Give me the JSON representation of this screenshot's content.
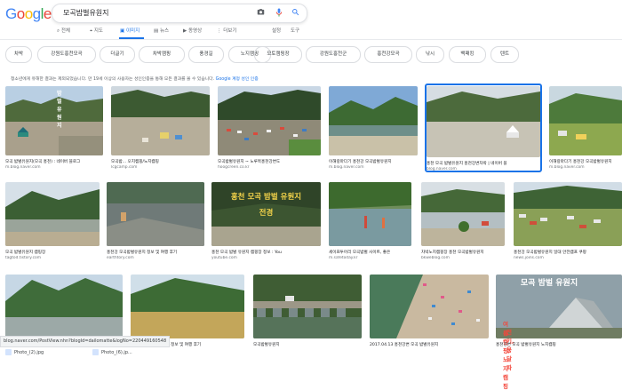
{
  "header": {
    "logo": "Google",
    "search_query": "모곡밤벌유원지",
    "settings_label": "설정",
    "tools_label": "도구"
  },
  "tabs": [
    {
      "label": "전체",
      "icon": "search-icon"
    },
    {
      "label": "지도",
      "icon": "map-pin-icon"
    },
    {
      "label": "이미지",
      "icon": "image-icon"
    },
    {
      "label": "뉴스",
      "icon": "news-icon"
    },
    {
      "label": "동영상",
      "icon": "video-icon"
    },
    {
      "label": "더보기",
      "icon": "more-icon"
    }
  ],
  "chips": [
    "차박",
    "강원도홍천모곡",
    "더글기",
    "차박캠핑",
    "풍경길",
    "노지캠핑",
    "모토캠핑장",
    "강원도홍천군",
    "홍천강모곡",
    "낚시",
    "백패킹",
    "텐트"
  ],
  "notice": {
    "text": "청소년에게 유해한 결과는 제외되었습니다. 만 19세 이상의 사용자는 성인인증을 통해 모든 결과를 볼 수 있습니다.",
    "link": "Google 계정 성인 인증"
  },
  "images": [
    {
      "caption": "모곡 밤벌유원지(모곡 홍천) : 네이버 블로그",
      "source": "m.blog.naver.com"
    },
    {
      "caption": "모곡밤... 오지캠핑/노지캠핑",
      "source": "lcgcamp.com"
    },
    {
      "caption": "모곡밤벌유원지 ~ 노루목홍천강변도",
      "source": "hoogcreen.co.kr"
    },
    {
      "caption": "이해랑마다기 홍천강 모곡밤벌유원지",
      "source": "m.blog.naver.com"
    },
    {
      "caption": "홍천 모곡 밤벌유원지 홍천강변차박 | 네이버 블",
      "source": "blog.naver.com"
    },
    {
      "caption": "이해랑마다기 홍천강 모곡밤벌유원지",
      "source": "m.blog.naver.com"
    },
    {
      "caption": "모곡 밤벌유원지 캠핑장",
      "source": "tagtod.tistory.com"
    },
    {
      "caption": "홍천강 모곡밤벌유원지 정보 및 여행 후기",
      "source": "earthtory.com"
    },
    {
      "caption": "홍천 모곡 밤벌 유원지 캠핑장 정보 : You",
      "source": "youtube.com"
    },
    {
      "caption": "세이프투어리 모곡밤벌 사이트, 좋은",
      "source": "m.safetoday.kr"
    },
    {
      "caption": "차박노지캠핑장 홍천 모곡밤벌유원지",
      "source": "bkweblog.com"
    },
    {
      "caption": "홍천강 모곡밤벌유원지 일대 안전캠프 쿠팡",
      "source": "news.joins.com"
    },
    {
      "caption": "blog.naver.com",
      "source": ""
    },
    {
      "caption": "홍천강 모곡밤벌유원지 정보 및 여행 후기",
      "source": ""
    },
    {
      "caption": "모곡밤벌유원지",
      "source": ""
    },
    {
      "caption": "2017.04.13 홍천강변 모곡 밤벌유원지",
      "source": ""
    },
    {
      "caption": "홍천강변 모곡 밤벌유원지 노지캠핑",
      "source": ""
    }
  ],
  "overlays": {
    "img1": "밤벌 유원지",
    "img9_line1": "홍천 모곡 밤벌 유원지",
    "img9_line2": "전경",
    "img17_line1": "모곡 밤벌 유원지",
    "img17_line2": "여름캠핑/노지캠핑",
    "img17_line3": "전기,용달파"
  },
  "status_url": "blog.naver.com/PostView.nhn?blogId=dailomatte&logNo=220449160548",
  "downloads": [
    "Photo_(2).jpg",
    "Photo_(6).jp..."
  ]
}
